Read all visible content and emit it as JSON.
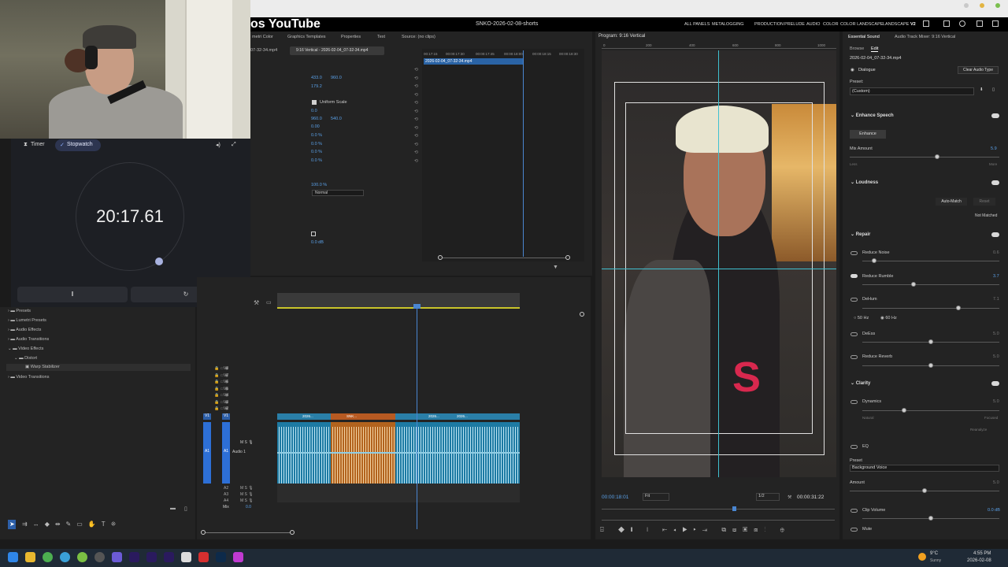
{
  "app": {
    "title": "os YouTube",
    "document": "SNKO-2026-02-08-shorts",
    "workspaces": [
      "ALL PANELS",
      "METALOGGING",
      "PRODUCTION",
      "PRELUDE",
      "AUDIO",
      "COLOR",
      "COLOR LANDSCAPE",
      "LANDSCAPE",
      "V2"
    ]
  },
  "timer": {
    "tab_timer": "Timer",
    "tab_stopwatch": "Stopwatch",
    "time": "20:17.61",
    "pause_icon": "‖",
    "reset_icon": "↻"
  },
  "effect_controls": {
    "tabs": [
      "metri Color",
      "Graphics Templates",
      "Properties",
      "Text",
      "Source: (no clips)"
    ],
    "master": "07-32-34.mp4",
    "sequence_tab": "9:16 Vertical - 2026-02-04_07-32-34.mp4",
    "values": [
      "433.0",
      "960.0",
      "179.2",
      "Uniform Scale",
      "0.0",
      "960.0",
      "540.0",
      "0.00",
      "0.0 %",
      "0.0 %",
      "0.0 %",
      "0.0 %",
      "100.0 %",
      "Normal",
      "0.0 dB"
    ],
    "timecodes": [
      "00:17:15",
      "00:00:17:30",
      "00:00:17:45",
      "00:00:18:00",
      "00:00:18:15",
      "00:00:18:30"
    ],
    "clip": "2026-02-04_07-32-34.mp4"
  },
  "project": {
    "items": [
      "Presets",
      "Lumetri Presets",
      "Audio Effects",
      "Audio Transitions",
      "Video Effects",
      "Distort",
      "Warp Stabilizer",
      "Video Transitions"
    ]
  },
  "timeline": {
    "video_tracks": [
      "V8",
      "V7",
      "V6",
      "V5",
      "V4",
      "V3",
      "V2",
      "V1"
    ],
    "audio_tracks": [
      "A1",
      "A2",
      "A3",
      "A4"
    ],
    "audio_label": "Audio 1",
    "mix_label": "Mix",
    "mix_value": "0.0",
    "clip_labels": [
      "2026...",
      "SNK...",
      "2026...",
      "2026..."
    ]
  },
  "program": {
    "title": "Program: 9:16 Vertical",
    "ruler": [
      "0",
      "200",
      "400",
      "600",
      "800",
      "1000"
    ],
    "timecode": "00:00:18:01",
    "fit": "Fit",
    "quality": "1/2",
    "duration": "00:00:31:22"
  },
  "essential_sound": {
    "tabs": [
      "Essential Sound",
      "Audio Track Mixer: 9:16 Vertical"
    ],
    "browse": "Browse",
    "edit": "Edit",
    "clip": "2026-02-04_07-32-34.mp4",
    "type": "Dialogue",
    "clear": "Clear Audio Type",
    "preset_label": "Preset:",
    "preset_value": "(Custom)",
    "enhance_speech": "Enhance Speech",
    "enhance_btn": "Enhance",
    "mix_amount": "Mix Amount",
    "mix_value": "5.9",
    "less": "Less",
    "more": "More",
    "loudness": "Loudness",
    "auto_match": "Auto-Match",
    "reset": "Reset",
    "not_matched": "Not Matched",
    "repair": "Repair",
    "reduce_noise": "Reduce Noise",
    "reduce_noise_v": "0.6",
    "reduce_rumble": "Reduce Rumble",
    "reduce_rumble_v": "3.7",
    "dehum": "DeHum",
    "dehum_v": "7.1",
    "hz50": "50 Hz",
    "hz60": "60 Hz",
    "deess": "DeEss",
    "deess_v": "5.0",
    "reduce_reverb": "Reduce Reverb",
    "reduce_reverb_v": "5.0",
    "clarity": "Clarity",
    "dynamics": "Dynamics",
    "dyn_v": "5.0",
    "natural": "Natural",
    "focused": "Focused",
    "reanalyze": "Reanalyze",
    "eq": "EQ",
    "eq_preset_label": "Preset",
    "eq_preset": "Background Voice",
    "amount": "Amount",
    "amount_v": "5.0",
    "clip_volume": "Clip Volume",
    "clip_volume_v": "0.0 dB",
    "mute": "Mute"
  },
  "taskbar": {
    "weather_temp": "9°C",
    "weather": "Sunny",
    "time": "4:55 PM",
    "date": "2026-02-08"
  }
}
